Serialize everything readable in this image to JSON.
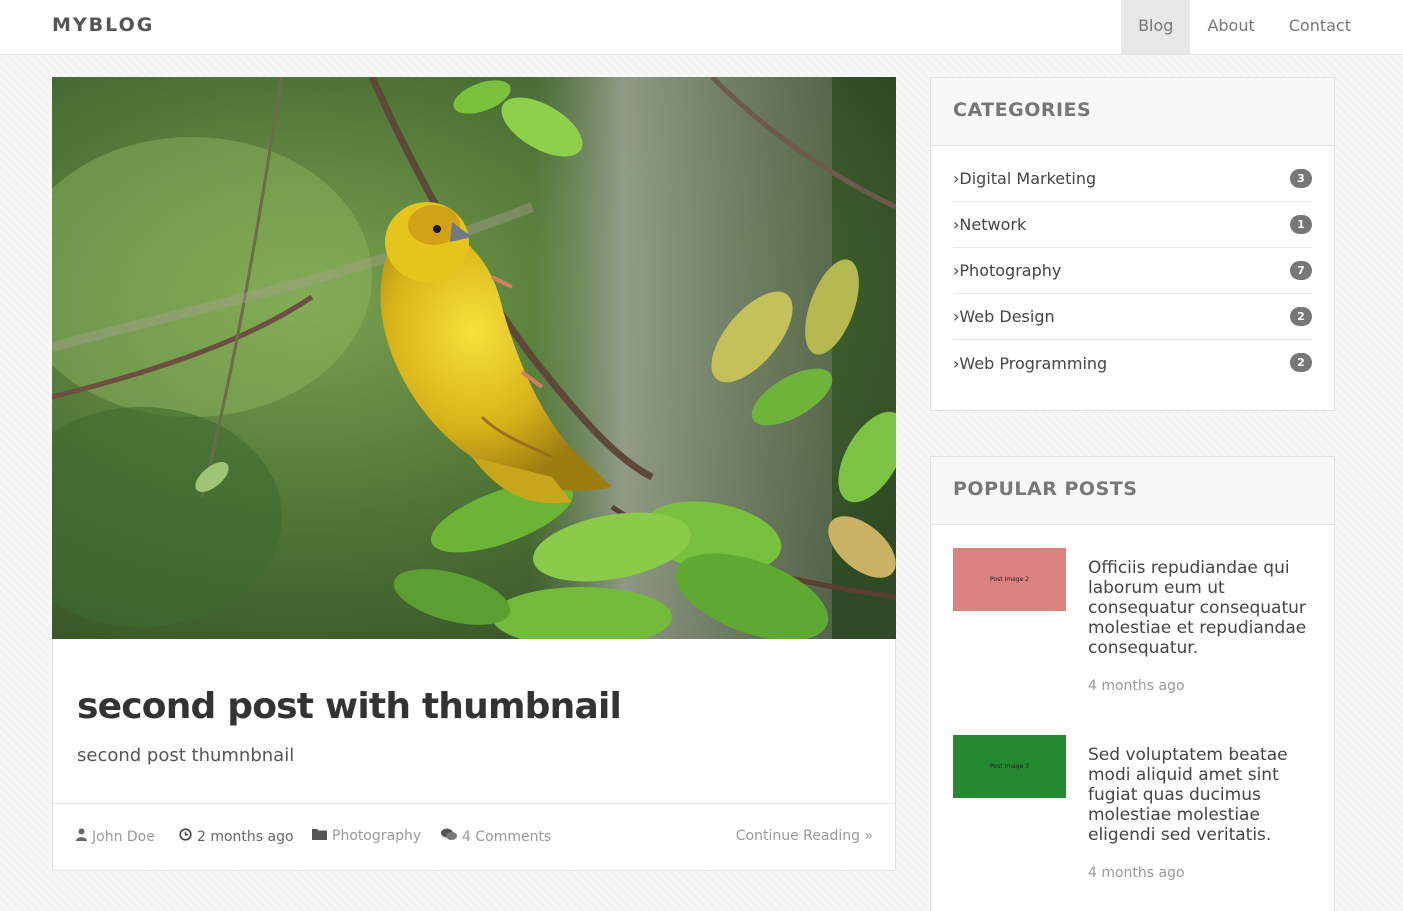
{
  "navbar": {
    "brand": "MYBLOG",
    "links": [
      {
        "label": "Blog",
        "active": true
      },
      {
        "label": "About",
        "active": false
      },
      {
        "label": "Contact",
        "active": false
      }
    ]
  },
  "post": {
    "title": "second post with thumbnail",
    "excerpt": "second post thumnbnail",
    "author": "John Doe",
    "time": "2 months ago",
    "category": "Photography",
    "comments": "4 Comments",
    "continue_label": "Continue Reading »"
  },
  "categories": {
    "heading": "CATEGORIES",
    "items": [
      {
        "name": "Digital Marketing",
        "count": "3"
      },
      {
        "name": "Network",
        "count": "1"
      },
      {
        "name": "Photography",
        "count": "7"
      },
      {
        "name": "Web Design",
        "count": "2"
      },
      {
        "name": "Web Programming",
        "count": "2"
      }
    ]
  },
  "popular": {
    "heading": "POPULAR POSTS",
    "items": [
      {
        "thumb_label": "Post Image 2",
        "thumb_color": "#d9827f",
        "title": "Officiis repudiandae qui laborum eum ut consequatur consequatur molestiae et repudiandae consequatur.",
        "date": "4 months ago"
      },
      {
        "thumb_label": "Post Image 3",
        "thumb_color": "#238a2f",
        "title": "Sed voluptatem beatae modi aliquid amet sint fugiat quas ducimus molestiae molestiae eligendi sed veritatis.",
        "date": "4 months ago"
      }
    ]
  },
  "colors": {
    "badge": "#777777",
    "heading_bg": "#f7f7f7",
    "active_nav_bg": "#e7e7e7"
  }
}
